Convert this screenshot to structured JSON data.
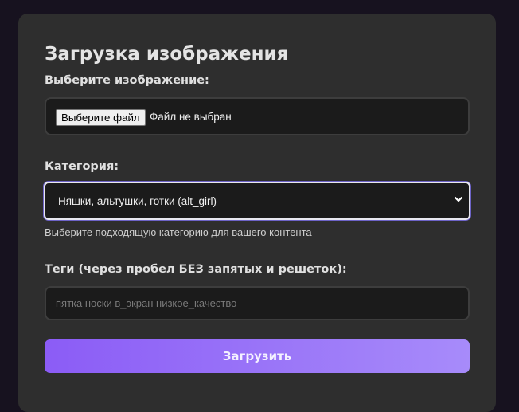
{
  "form": {
    "title": "Загрузка изображения",
    "image_label": "Выберите изображение:",
    "file_button_label": "Выберите файл",
    "file_status": "Файл не выбран",
    "category_label": "Категория:",
    "category_selected": "Няшки, альтушки, готки (alt_girl)",
    "category_hint": "Выберите подходящую категорию для вашего контента",
    "tags_label": "Теги (через пробел БЕЗ запятых и решеток):",
    "tags_placeholder": "пятка носки в_экран низкое_качество",
    "submit_label": "Загрузить"
  },
  "colors": {
    "page_background": "#17121f",
    "card_background": "#2e2e2e",
    "field_background": "#1b1b1b",
    "accent_start": "#8b5cf6",
    "accent_end": "#a78bfa"
  },
  "icons": {
    "select_arrow": "chevron-down-icon"
  }
}
